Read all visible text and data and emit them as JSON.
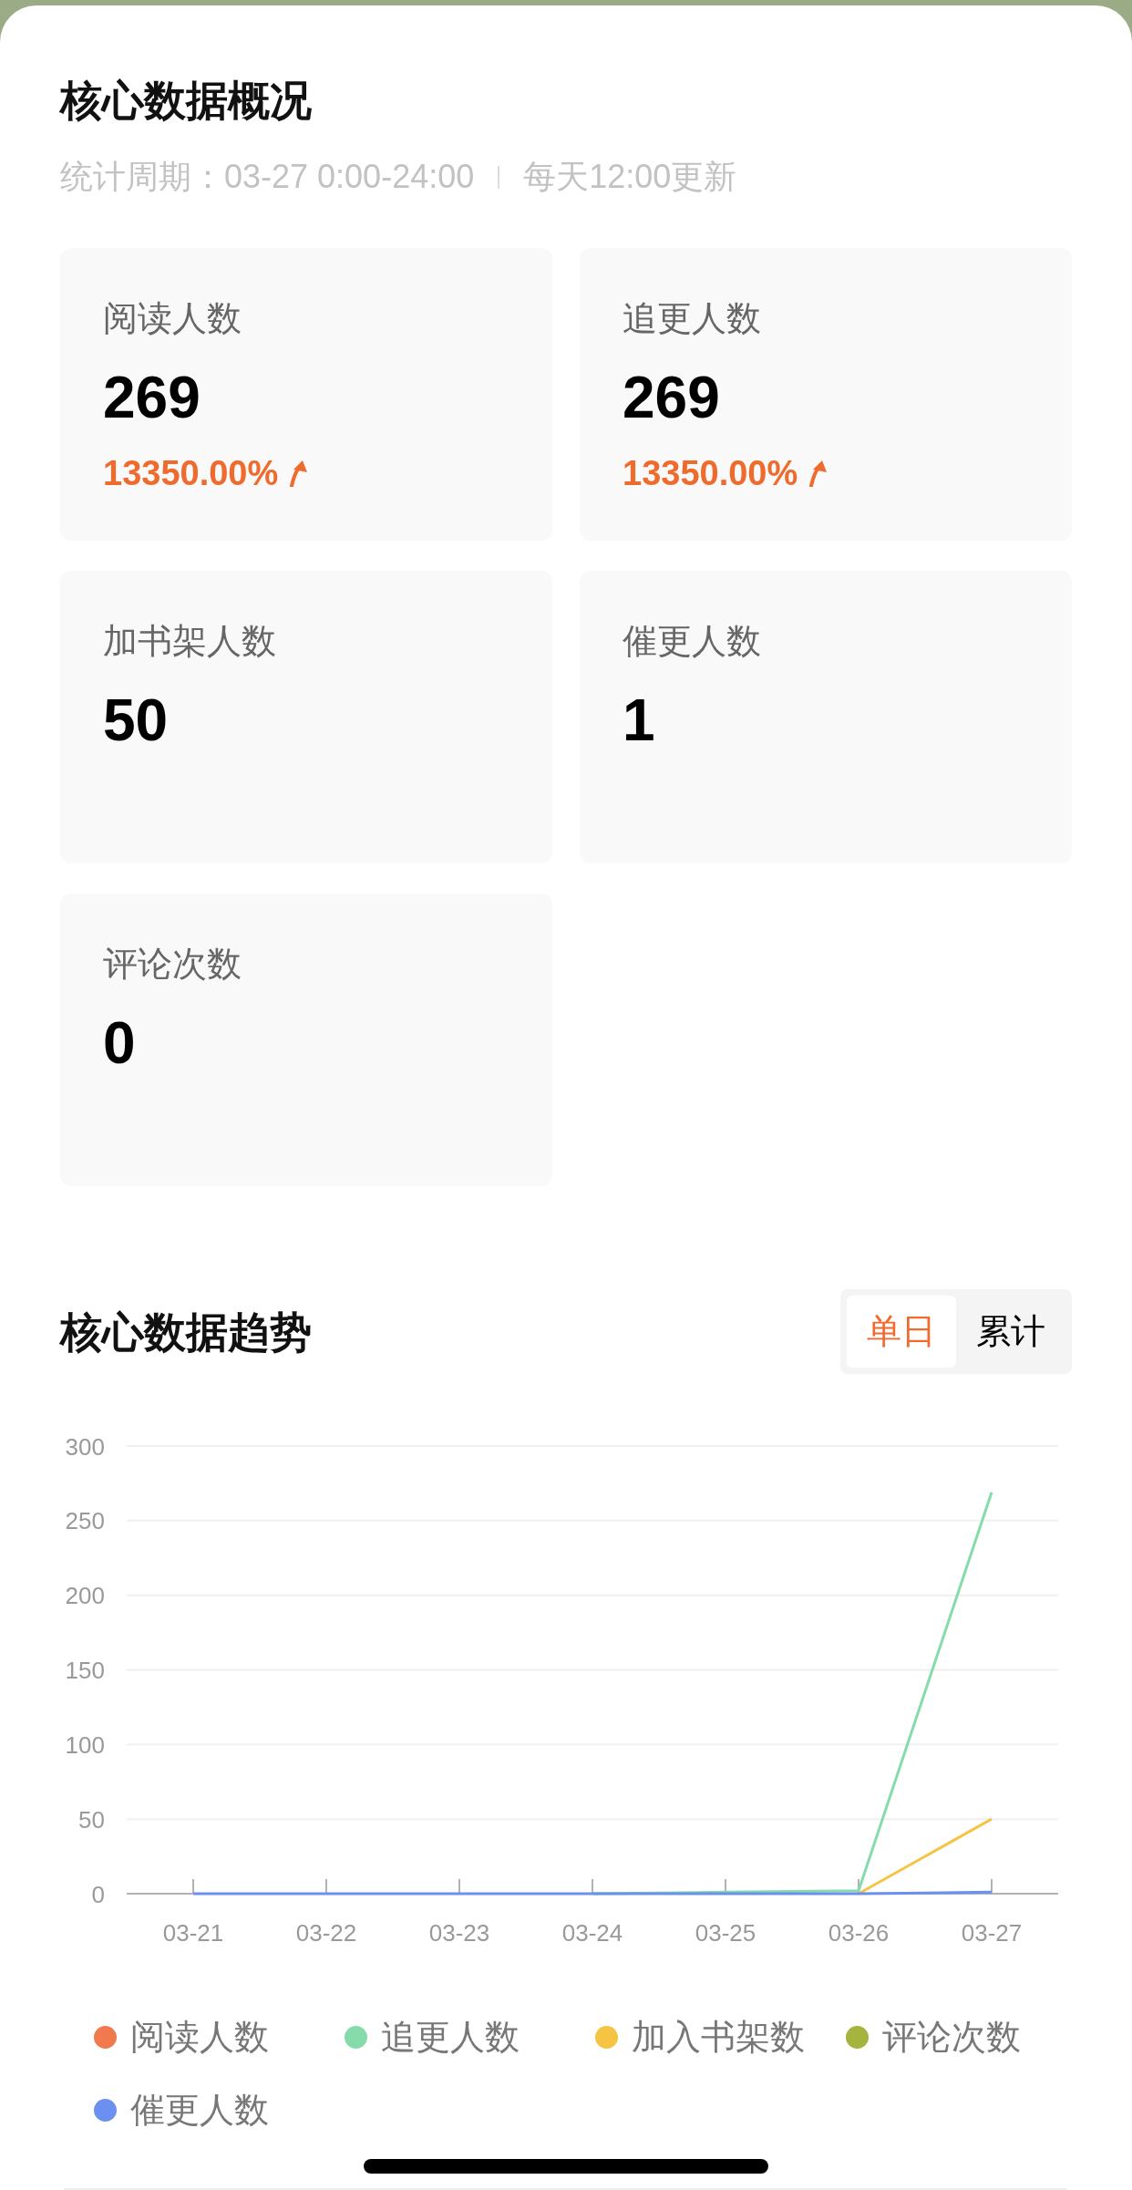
{
  "overview": {
    "title": "核心数据概况",
    "period": "统计周期：03-27 0:00-24:00",
    "update_note": "每天12:00更新",
    "cards": [
      {
        "label": "阅读人数",
        "value": "269",
        "change": "13350.00%",
        "rising": true
      },
      {
        "label": "追更人数",
        "value": "269",
        "change": "13350.00%",
        "rising": true
      },
      {
        "label": "加书架人数",
        "value": "50"
      },
      {
        "label": "催更人数",
        "value": "1"
      },
      {
        "label": "评论次数",
        "value": "0"
      }
    ]
  },
  "trend": {
    "title": "核心数据趋势",
    "toggle": [
      {
        "label": "单日",
        "selected": true
      },
      {
        "label": "累计",
        "selected": false
      }
    ],
    "chart_data": {
      "type": "line",
      "categories": [
        "03-21",
        "03-22",
        "03-23",
        "03-24",
        "03-25",
        "03-26",
        "03-27"
      ],
      "series": [
        {
          "name": "阅读人数",
          "color": "#f07a4e",
          "values": [
            null,
            null,
            null,
            null,
            null,
            null,
            null
          ]
        },
        {
          "name": "追更人数",
          "color": "#86dbab",
          "values": [
            null,
            null,
            null,
            0,
            1,
            2,
            269
          ]
        },
        {
          "name": "加入书架数",
          "color": "#f5c443",
          "values": [
            null,
            null,
            null,
            null,
            null,
            0,
            50
          ]
        },
        {
          "name": "评论次数",
          "color": "#a4b43c",
          "values": [
            null,
            null,
            null,
            null,
            null,
            null,
            null
          ]
        },
        {
          "name": "催更人数",
          "color": "#6b90f0",
          "values": [
            0,
            0,
            0,
            0,
            0,
            0,
            1
          ]
        }
      ],
      "ylim": [
        0,
        300
      ],
      "yticks": [
        0,
        50,
        100,
        150,
        200,
        250,
        300
      ],
      "grid": true
    }
  }
}
